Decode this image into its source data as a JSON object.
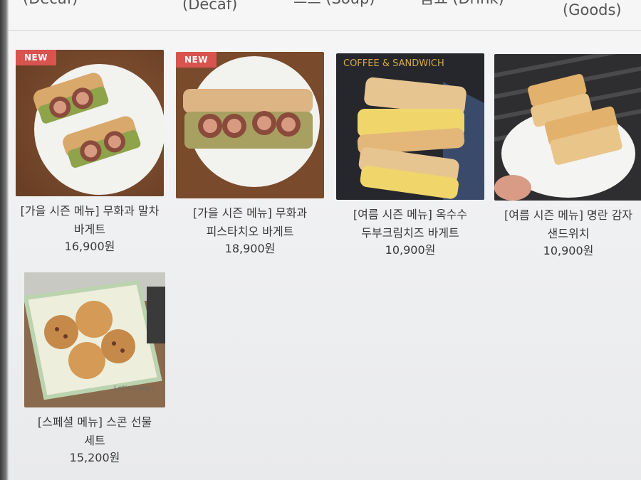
{
  "tabs": [
    {
      "label": "(Decaf)"
    },
    {
      "label": "(Decaf)"
    },
    {
      "label": "스프 (Soup)"
    },
    {
      "label": "음료 (Drink)"
    },
    {
      "label": "(Goods)"
    }
  ],
  "menu_items": [
    {
      "badge": "NEW",
      "name": "[가을 시즌 메뉴] 무화과 말차 바게트",
      "price": "16,900원"
    },
    {
      "badge": "NEW",
      "name": "[가을 시즌 메뉴] 무화과 피스타치오 바게트",
      "price": "18,900원"
    },
    {
      "badge": "",
      "name": "[여름 시즌 메뉴] 옥수수 두부크림치즈 바게트",
      "price": "10,900원",
      "image_text": "COFFEE & SANDWICH"
    },
    {
      "badge": "",
      "name": "[여름 시즌 메뉴] 명란 감자 샌드위치",
      "price": "10,900원"
    },
    {
      "badge": "",
      "name": "[스페셜 메뉴] 스콘 선물 세트",
      "price": "15,200원",
      "image_text": "Let's Daily!"
    }
  ]
}
